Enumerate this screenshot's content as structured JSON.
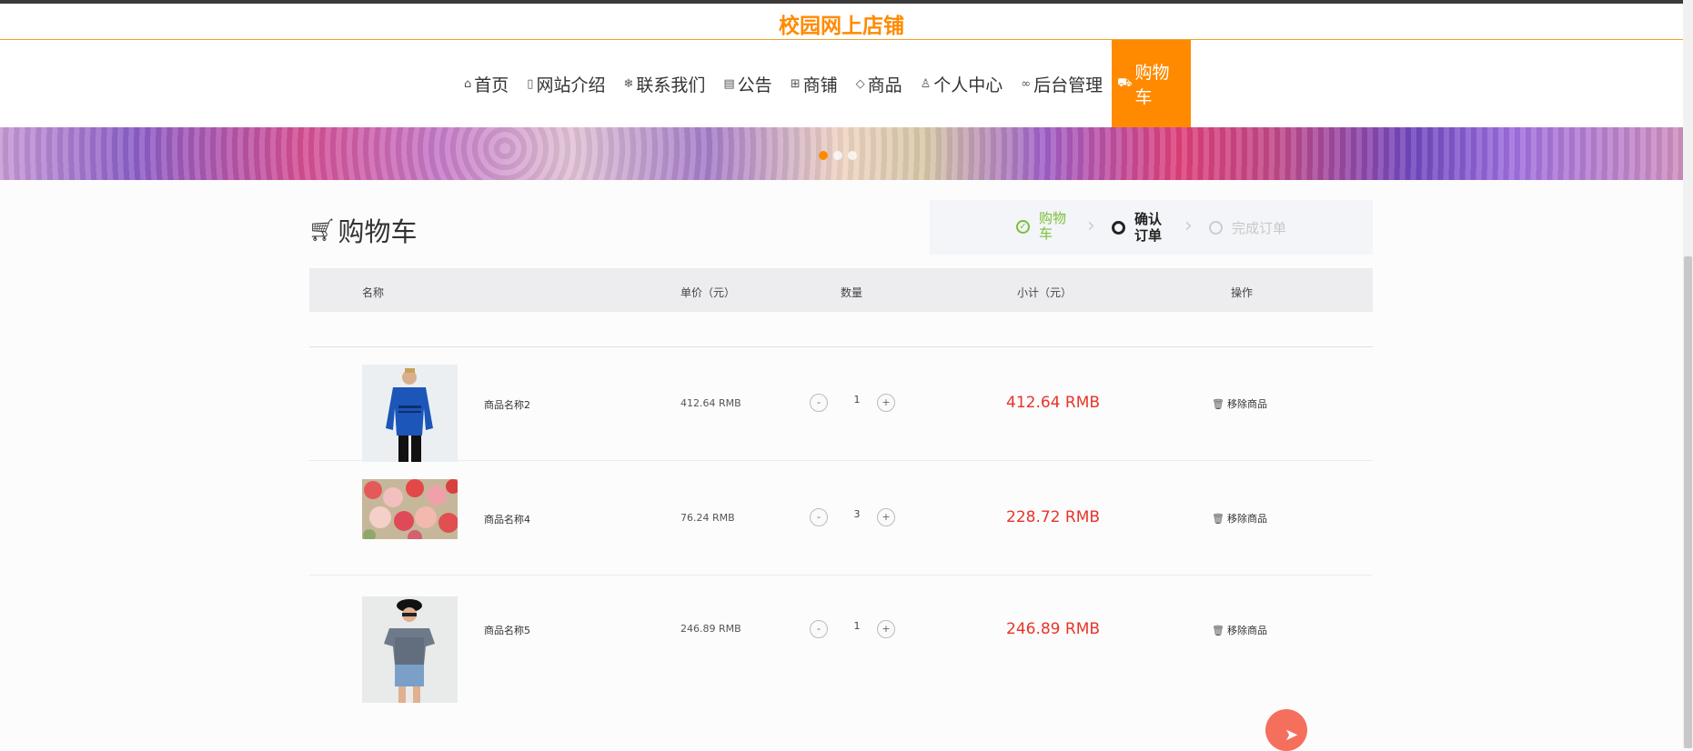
{
  "header": {
    "site_title": "校园网上店铺"
  },
  "nav": {
    "items": [
      {
        "icon": "home-icon",
        "label": "首页"
      },
      {
        "icon": "document-icon",
        "label": "网站介绍"
      },
      {
        "icon": "snowflake-icon",
        "label": "联系我们"
      },
      {
        "icon": "calendar-icon",
        "label": "公告"
      },
      {
        "icon": "grid-icon",
        "label": "商铺"
      },
      {
        "icon": "tag-icon",
        "label": "商品"
      },
      {
        "icon": "user-icon",
        "label": "个人中心"
      },
      {
        "icon": "link-icon",
        "label": "后台管理"
      },
      {
        "icon": "cart-icon",
        "label": "购物车",
        "active": true
      }
    ]
  },
  "page": {
    "title": "购物车",
    "steps": [
      {
        "label": "购物车",
        "state": "done"
      },
      {
        "label": "确认订单",
        "state": "current"
      },
      {
        "label": "完成订单",
        "state": "todo"
      }
    ]
  },
  "table": {
    "headers": {
      "name": "名称",
      "price": "单价（元）",
      "qty": "数量",
      "subtotal": "小计（元）",
      "action": "操作"
    },
    "rows": [
      {
        "name": "商品名称2",
        "price": "412.64 RMB",
        "qty": "1",
        "subtotal": "412.64 RMB",
        "remove": "移除商品",
        "image": "blue-sweater-photo"
      },
      {
        "name": "商品名称4",
        "price": "76.24 RMB",
        "qty": "3",
        "subtotal": "228.72 RMB",
        "remove": "移除商品",
        "image": "flowers-photo"
      },
      {
        "name": "商品名称5",
        "price": "246.89 RMB",
        "qty": "1",
        "subtotal": "246.89 RMB",
        "remove": "移除商品",
        "image": "woman-outfit-photo"
      }
    ],
    "qty_minus": "-",
    "qty_plus": "+"
  },
  "colors": {
    "accent": "#ff8a00",
    "price_red": "#e8342a",
    "step_done": "#7cbf3a"
  }
}
